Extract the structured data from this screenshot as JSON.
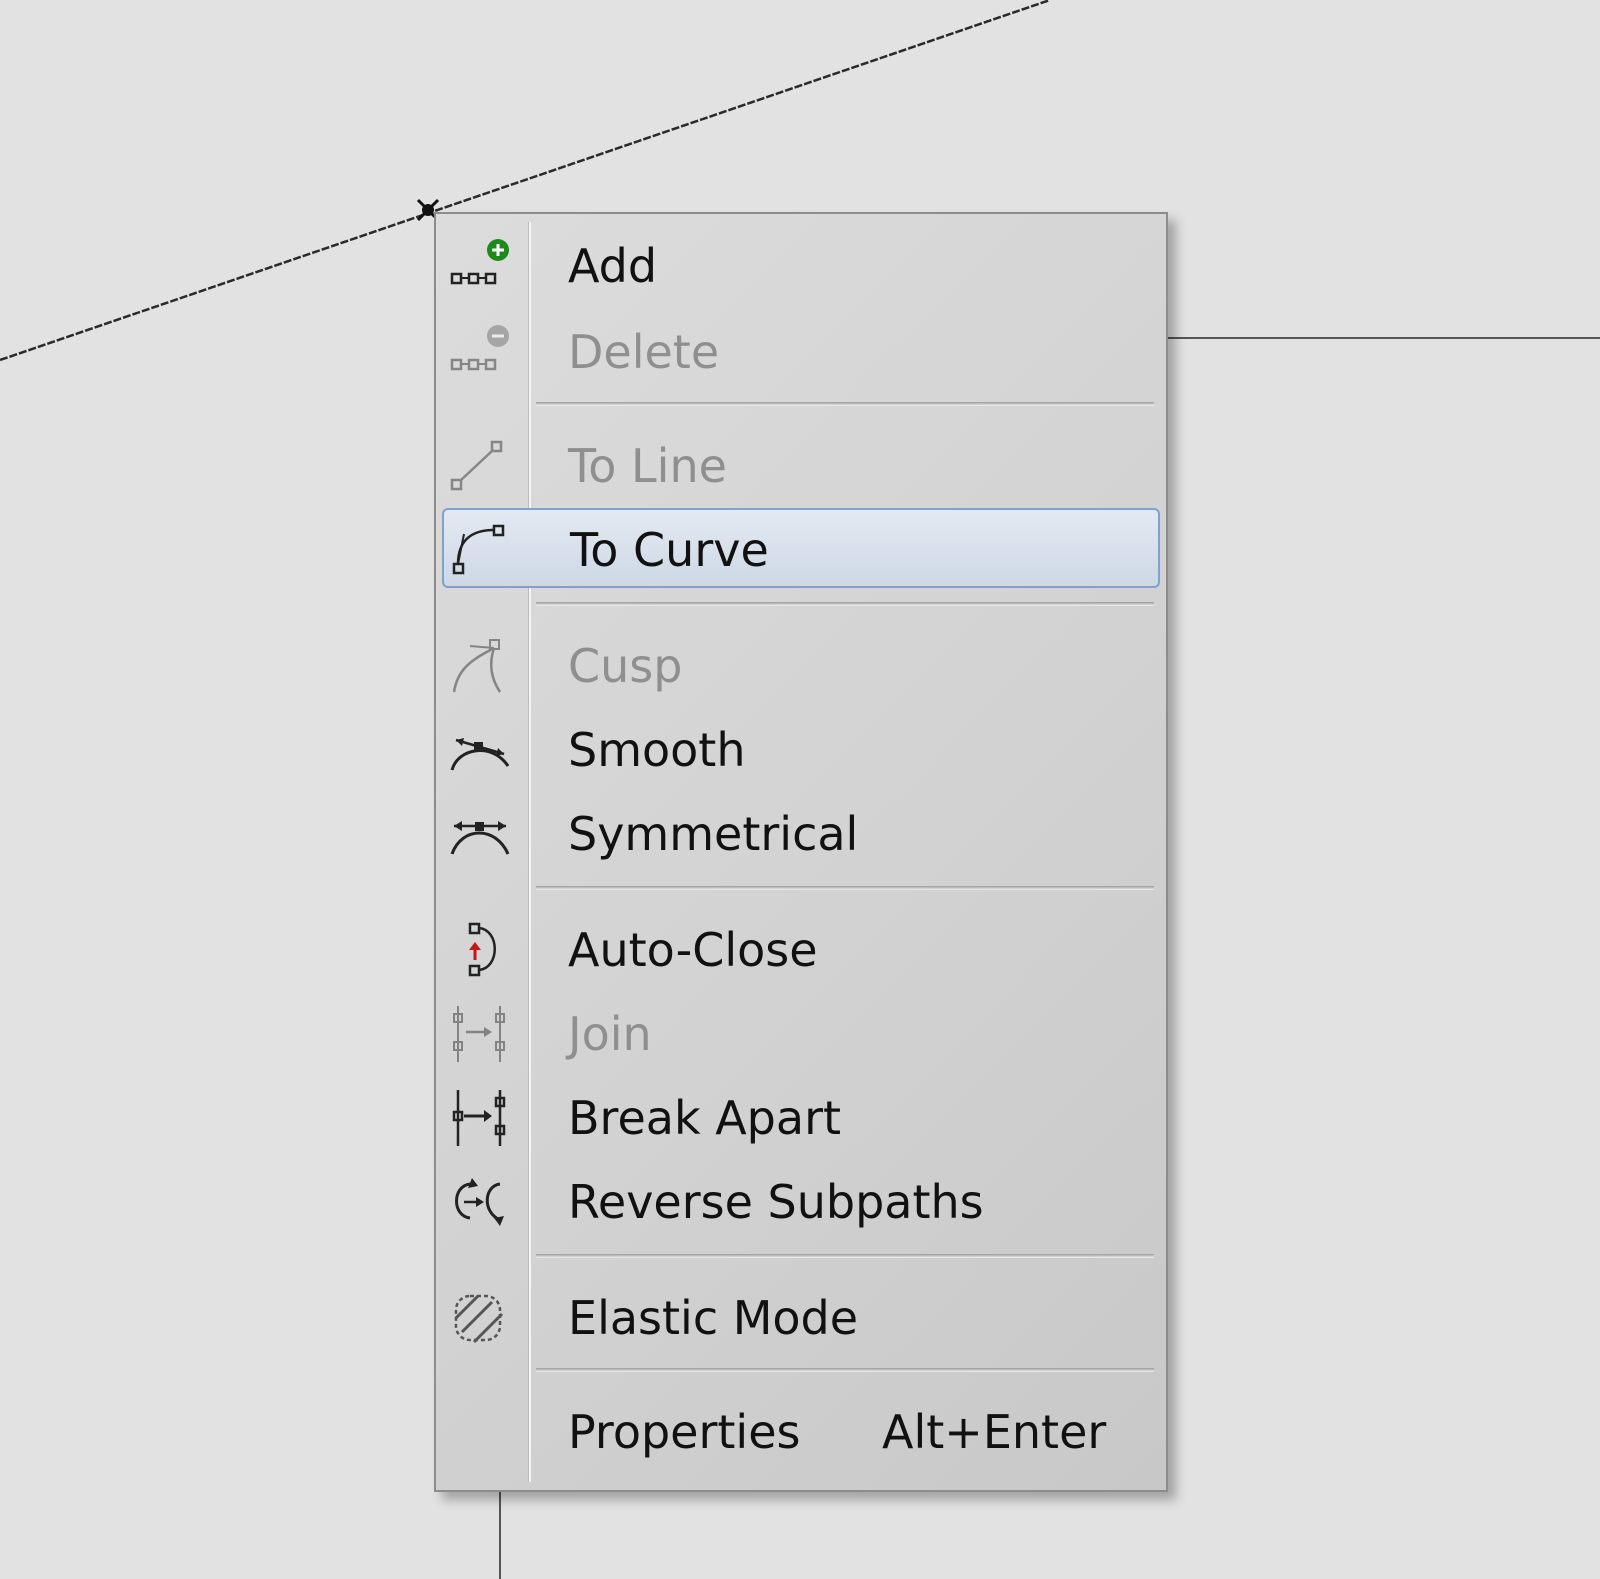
{
  "menu": {
    "items": [
      {
        "name": "add",
        "label": "Add",
        "enabled": true,
        "icon": "add-node-icon"
      },
      {
        "name": "delete",
        "label": "Delete",
        "enabled": false,
        "icon": "delete-node-icon"
      },
      {
        "name": "to-line",
        "label": "To Line",
        "enabled": false,
        "icon": "to-line-icon"
      },
      {
        "name": "to-curve",
        "label": "To Curve",
        "enabled": true,
        "highlighted": true,
        "icon": "to-curve-icon"
      },
      {
        "name": "cusp",
        "label": "Cusp",
        "enabled": false,
        "icon": "cusp-icon"
      },
      {
        "name": "smooth",
        "label": "Smooth",
        "enabled": true,
        "icon": "smooth-icon"
      },
      {
        "name": "symmetrical",
        "label": "Symmetrical",
        "enabled": true,
        "icon": "symmetrical-icon"
      },
      {
        "name": "auto-close",
        "label": "Auto-Close",
        "enabled": true,
        "icon": "auto-close-icon"
      },
      {
        "name": "join",
        "label": "Join",
        "enabled": false,
        "icon": "join-icon"
      },
      {
        "name": "break-apart",
        "label": "Break Apart",
        "enabled": true,
        "icon": "break-apart-icon"
      },
      {
        "name": "reverse-subpaths",
        "label": "Reverse Subpaths",
        "enabled": true,
        "icon": "reverse-subpaths-icon"
      },
      {
        "name": "elastic-mode",
        "label": "Elastic Mode",
        "enabled": true,
        "icon": "elastic-mode-icon"
      },
      {
        "name": "properties",
        "label": "Properties",
        "shortcut": "Alt+Enter",
        "enabled": true,
        "icon": ""
      }
    ]
  },
  "colors": {
    "highlight_border": "#7ea1d0",
    "disabled_text": "#8f8f8f",
    "add_badge": "#1e8a1e"
  }
}
